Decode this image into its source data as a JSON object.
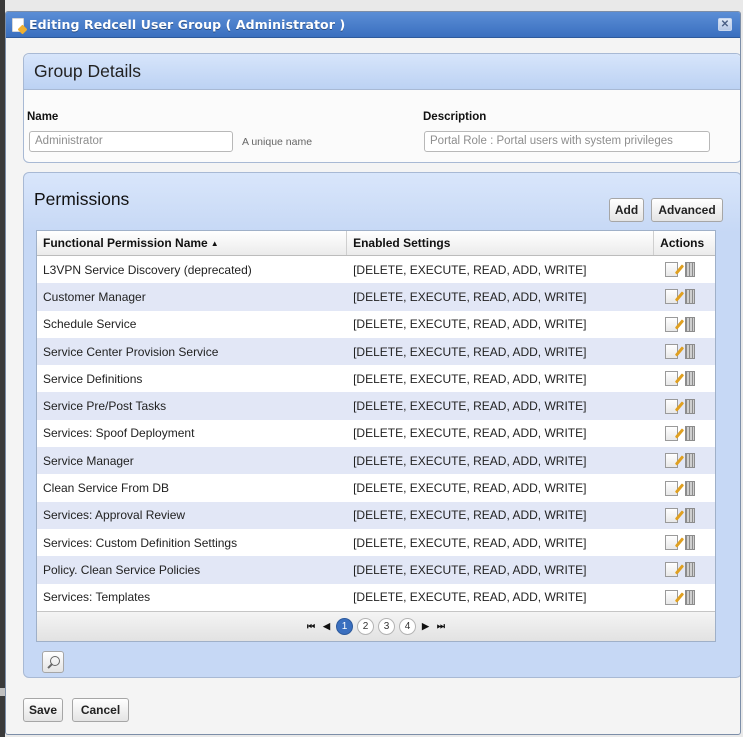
{
  "dialog": {
    "title": "Editing Redcell User Group ( Administrator )",
    "close_label": "✕"
  },
  "group_details": {
    "heading": "Group Details",
    "name_label": "Name",
    "name_value": "Administrator",
    "name_hint": "A unique name",
    "description_label": "Description",
    "description_value": "Portal Role : Portal users with system privileges"
  },
  "permissions": {
    "heading": "Permissions",
    "add_label": "Add",
    "advanced_label": "Advanced",
    "columns": [
      "Functional Permission Name",
      "Enabled Settings",
      "Actions"
    ],
    "sort_indicator": "▲",
    "rows": [
      {
        "name": "L3VPN Service Discovery (deprecated)",
        "settings": "[DELETE, EXECUTE, READ, ADD, WRITE]"
      },
      {
        "name": "Customer Manager",
        "settings": "[DELETE, EXECUTE, READ, ADD, WRITE]"
      },
      {
        "name": "Schedule Service",
        "settings": "[DELETE, EXECUTE, READ, ADD, WRITE]"
      },
      {
        "name": "Service Center Provision Service",
        "settings": "[DELETE, EXECUTE, READ, ADD, WRITE]"
      },
      {
        "name": "Service Definitions",
        "settings": "[DELETE, EXECUTE, READ, ADD, WRITE]"
      },
      {
        "name": "Service Pre/Post Tasks",
        "settings": "[DELETE, EXECUTE, READ, ADD, WRITE]"
      },
      {
        "name": "Services: Spoof Deployment",
        "settings": "[DELETE, EXECUTE, READ, ADD, WRITE]"
      },
      {
        "name": "Service Manager",
        "settings": "[DELETE, EXECUTE, READ, ADD, WRITE]"
      },
      {
        "name": "Clean Service From DB",
        "settings": "[DELETE, EXECUTE, READ, ADD, WRITE]"
      },
      {
        "name": "Services: Approval Review",
        "settings": "[DELETE, EXECUTE, READ, ADD, WRITE]"
      },
      {
        "name": "Services: Custom Definition Settings",
        "settings": "[DELETE, EXECUTE, READ, ADD, WRITE]"
      },
      {
        "name": "Policy. Clean Service Policies",
        "settings": "[DELETE, EXECUTE, READ, ADD, WRITE]"
      },
      {
        "name": "Services: Templates",
        "settings": "[DELETE, EXECUTE, READ, ADD, WRITE]"
      }
    ],
    "row_icons": [
      "edit-icon",
      "delete-icon"
    ],
    "pager": {
      "first": "⏮",
      "prev": "◀",
      "next": "▶",
      "last": "⏭",
      "pages": [
        "1",
        "2",
        "3",
        "4"
      ],
      "current_page": "1"
    }
  },
  "footer": {
    "save_label": "Save",
    "cancel_label": "Cancel"
  },
  "colors": {
    "titlebar": "#3a6fbf",
    "panel_header": "#c6d8f5",
    "alt_row": "#e2e7f6",
    "active_page": "#3a6fbf"
  }
}
